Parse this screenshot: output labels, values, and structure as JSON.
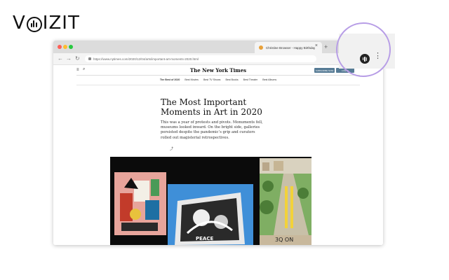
{
  "brand": {
    "name": "VOIZIT",
    "prefix": "V",
    "suffix": "IZIT",
    "logo_icon": "soundwave-icon"
  },
  "browser": {
    "tab_title": "Christine Browser - Happy Birthday",
    "url": "https://www.nytimes.com/2020/12/04/arts/important-art-moments-2020.html",
    "new_tab": "+",
    "close": "×",
    "nav": {
      "back": "←",
      "forward": "→",
      "reload": "↻"
    }
  },
  "nyt": {
    "masthead": "The New York Times",
    "menu_icon": "≡",
    "search_icon": "⌕",
    "subscribe_label": "SUBSCRIBE NOW",
    "login_label": "LOG IN",
    "subnav": [
      "The Best of 2020",
      "Best Movies",
      "Best TV Shows",
      "Best Books",
      "Best Theater",
      "Best Albums"
    ],
    "headline": "The Most Important Moments in Art in 2020",
    "deck": "This was a year of protests and pivots. Monuments fell, museums looked inward. On the bright side, galleries persisted despite the pandemic’s grip and curators rolled out magisterial retrospectives.",
    "share_icon": "⤴"
  },
  "collage": {
    "sign_text": "PEACE",
    "bottom_text": "3Q ON"
  },
  "extension": {
    "icon_name": "voizit-extension-icon",
    "more": "⋮"
  },
  "colors": {
    "accent": "#b79de6",
    "button": "#567b95"
  }
}
